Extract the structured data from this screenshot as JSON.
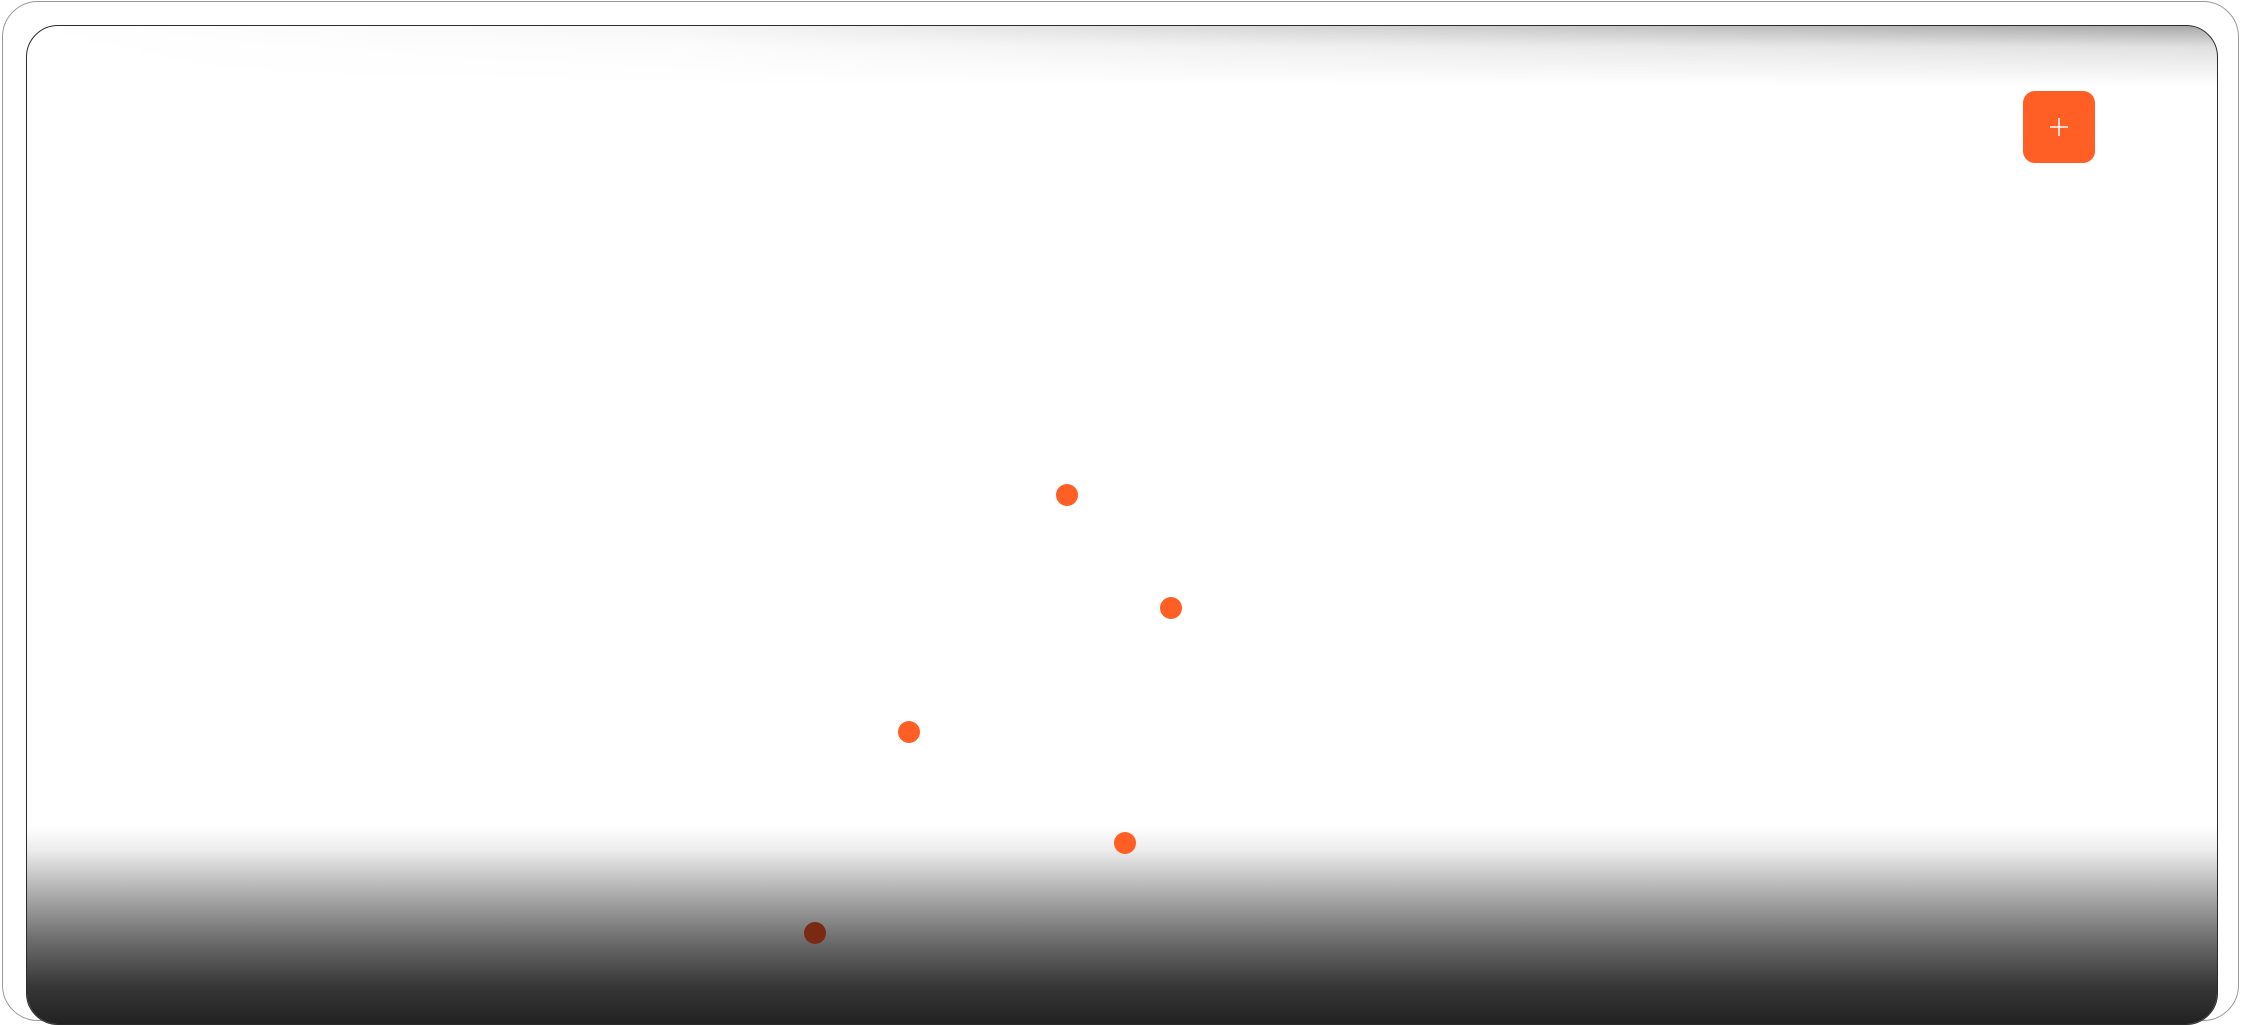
{
  "colors": {
    "accent": "#ff5f24",
    "accent_dark": "#7a2a12",
    "icon_stroke": "#ffffff"
  },
  "toolbar": {
    "add_button_icon": "plus-icon"
  },
  "points": [
    {
      "id": 1,
      "color": "#ff5f24"
    },
    {
      "id": 2,
      "color": "#ff5f24"
    },
    {
      "id": 3,
      "color": "#ff5f24"
    },
    {
      "id": 4,
      "color": "#ff5f24"
    },
    {
      "id": 5,
      "color": "#7a2a12"
    }
  ]
}
